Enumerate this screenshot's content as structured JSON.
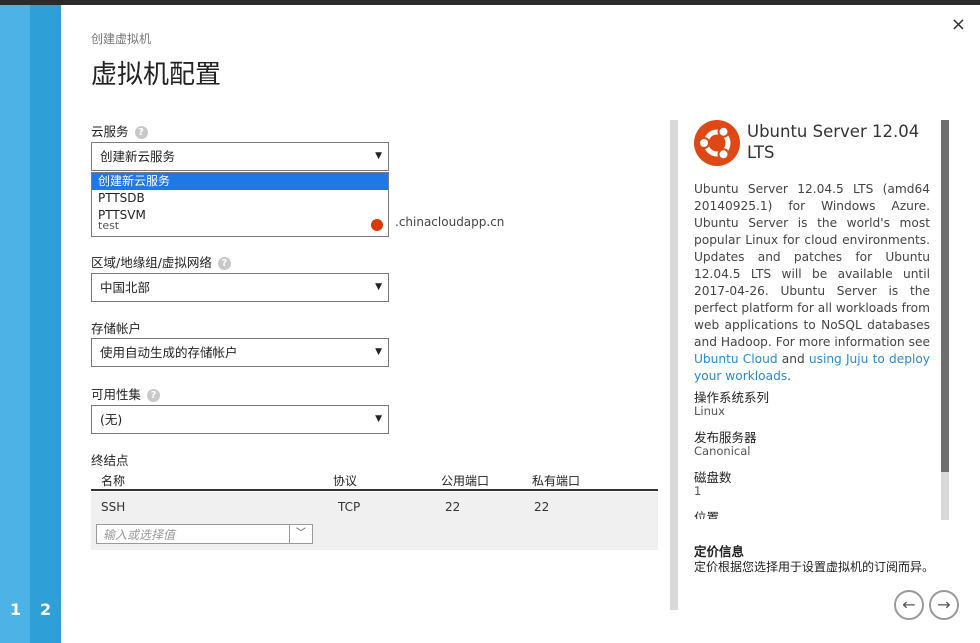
{
  "wizard": {
    "breadcrumb": "创建虚拟机",
    "title": "虚拟机配置",
    "steps": [
      "1",
      "2"
    ],
    "close_label": "×"
  },
  "form": {
    "cloud_service": {
      "label": "云服务",
      "value": "创建新云服务",
      "options": [
        "创建新云服务",
        "PTTSDB",
        "PTTSVM"
      ]
    },
    "dns": {
      "value": "test",
      "suffix": ".chinacloudapp.cn"
    },
    "region": {
      "label": "区域/地缘组/虚拟网络",
      "value": "中国北部"
    },
    "storage": {
      "label": "存储帐户",
      "value": "使用自动生成的存储帐户"
    },
    "availability": {
      "label": "可用性集",
      "value": "(无)"
    },
    "endpoints": {
      "label": "终结点",
      "columns": [
        "名称",
        "协议",
        "公用端口",
        "私有端口"
      ],
      "rows": [
        {
          "name": "SSH",
          "protocol": "TCP",
          "public": "22",
          "private": "22"
        }
      ],
      "input_placeholder": "输入或选择值"
    }
  },
  "side": {
    "image_title": "Ubuntu Server 12.04 LTS",
    "description": "Ubuntu Server 12.04.5 LTS (amd64 20140925.1) for Windows Azure. Ubuntu Server is the world's most popular Linux for cloud environments. Updates and patches for Ubuntu 12.04.5 LTS will be available until 2017-04-26. Ubuntu Server is the perfect platform for all workloads from web applications to NoSQL databases and Hadoop. For more information see",
    "link1": "Ubuntu Cloud",
    "link_join": "and",
    "link2": "using Juju to deploy your workloads",
    "desc_end": ".",
    "os_family_label": "操作系统系列",
    "os_family": "Linux",
    "publisher_label": "发布服务器",
    "publisher": "Canonical",
    "disks_label": "磁盘数",
    "disks": "1",
    "location_label": "位置",
    "pricing_title": "定价信息",
    "pricing_desc": "定价根据您选择用于设置虚拟机的订阅而异。"
  },
  "nav": {
    "back": "←",
    "next": "→"
  },
  "icons": {
    "help": "question-circle-icon",
    "caret": "caret-down-icon",
    "ubuntu": "ubuntu-logo-icon"
  },
  "colors": {
    "accent": "#2f9fd8",
    "accent_light": "#4db3e6",
    "selection": "#1e78e6",
    "ubuntu": "#dd4814",
    "link": "#2a8ad4"
  }
}
